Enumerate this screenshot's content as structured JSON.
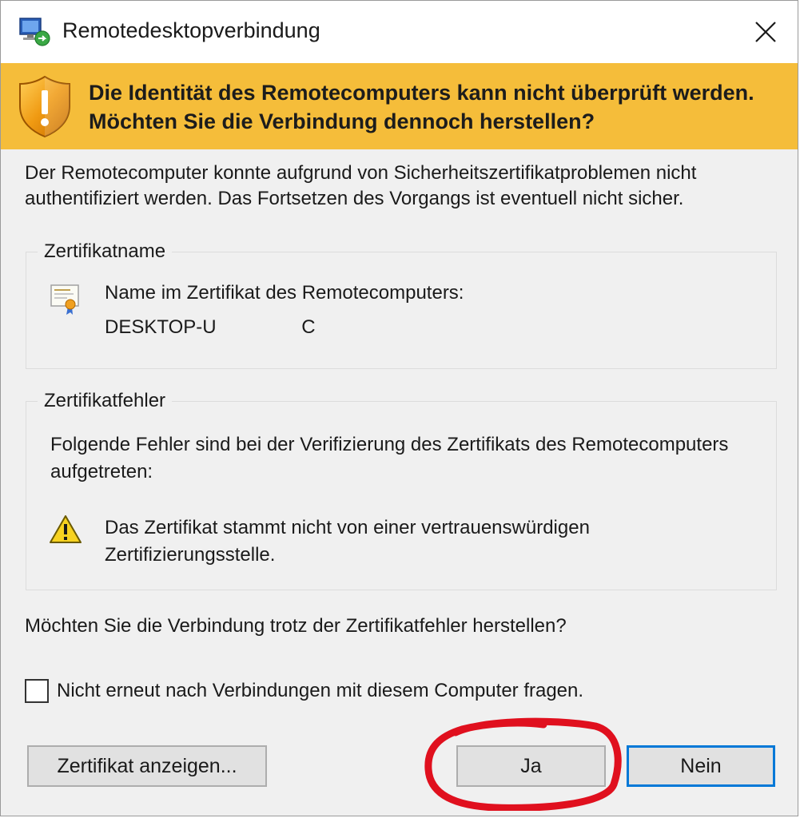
{
  "window": {
    "title": "Remotedesktopverbindung"
  },
  "banner": {
    "message": "Die Identität des Remotecomputers kann nicht überprüft werden. Möchten Sie die Verbindung dennoch herstellen?",
    "background_color": "#f5bd3a"
  },
  "intro": "Der Remotecomputer konnte aufgrund von Sicherheitszertifikatproblemen nicht authentifiziert werden. Das Fortsetzen des Vorgangs ist eventuell nicht sicher.",
  "certificate_group": {
    "label": "Zertifikatname",
    "name_label": "Name im Zertifikat des Remotecomputers:",
    "name_value": "DESKTOP-U                C"
  },
  "error_group": {
    "label": "Zertifikatfehler",
    "description": "Folgende Fehler sind bei der Verifizierung des Zertifikats des Remotecomputers aufgetreten:",
    "errors": [
      "Das Zertifikat stammt nicht von einer vertrauenswürdigen Zertifizierungsstelle."
    ]
  },
  "question": "Möchten Sie die Verbindung trotz der Zertifikatfehler herstellen?",
  "dont_ask_checkbox": {
    "label": "Nicht erneut nach Verbindungen mit diesem Computer fragen.",
    "checked": false
  },
  "buttons": {
    "show_certificate": "Zertifikat anzeigen...",
    "yes": "Ja",
    "no": "Nein"
  },
  "colors": {
    "accent_focus": "#0078d7",
    "annotation_circle": "#e0101e"
  }
}
